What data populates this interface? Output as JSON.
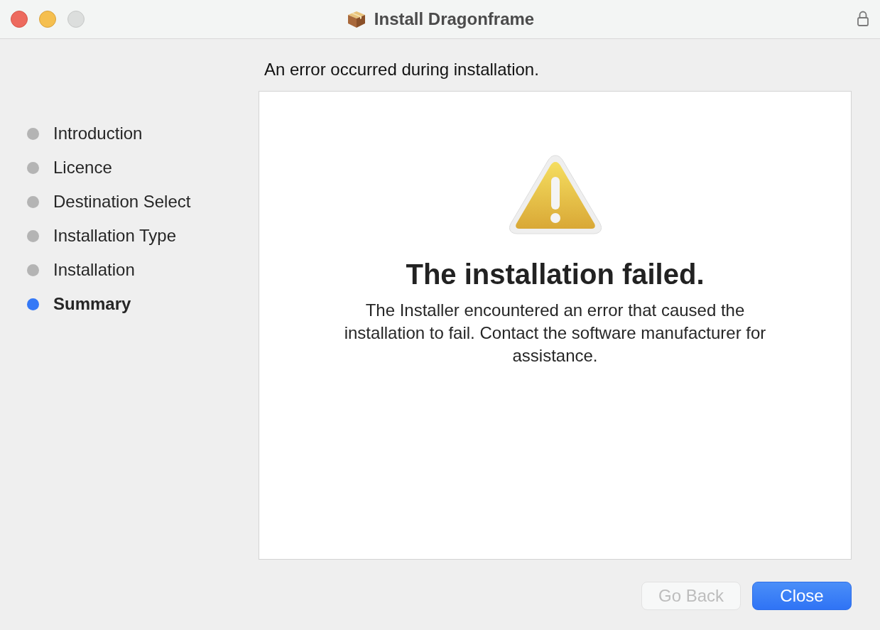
{
  "window": {
    "title": "Install Dragonframe"
  },
  "steps": [
    {
      "label": "Introduction",
      "selected": false
    },
    {
      "label": "Licence",
      "selected": false
    },
    {
      "label": "Destination Select",
      "selected": false
    },
    {
      "label": "Installation Type",
      "selected": false
    },
    {
      "label": "Installation",
      "selected": false
    },
    {
      "label": "Summary",
      "selected": true
    }
  ],
  "heading": "An error occurred during installation.",
  "summary": {
    "title": "The installation failed.",
    "message": "The Installer encountered an error that caused the installation to fail. Contact the software manufacturer for assistance."
  },
  "buttons": [
    {
      "label": "Go Back",
      "disabled": true,
      "default": false
    },
    {
      "label": "Close",
      "disabled": false,
      "default": true
    }
  ]
}
